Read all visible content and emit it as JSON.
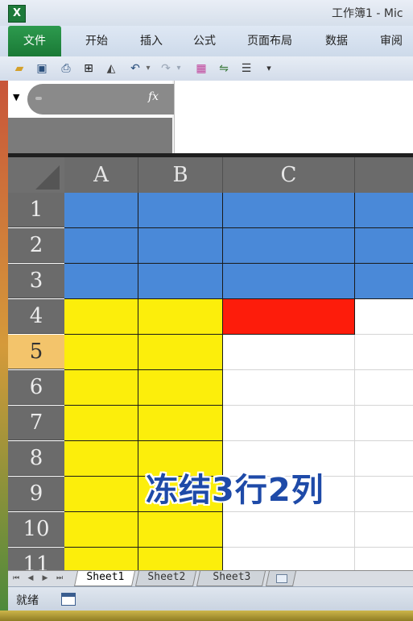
{
  "window": {
    "title": "工作簿1 - Mic"
  },
  "ribbon": {
    "tabs": [
      "文件",
      "开始",
      "插入",
      "公式",
      "页面布局",
      "数据",
      "审阅"
    ]
  },
  "quick_access": {
    "icons": [
      "open-folder-icon",
      "save-icon",
      "print-preview-icon",
      "borders-icon",
      "eraser-icon",
      "undo-icon",
      "redo-icon",
      "format-painter-icon",
      "sort-icon",
      "list-icon",
      "customize-icon"
    ]
  },
  "formula_bar": {
    "fx_label": "fx",
    "name_box_value": "",
    "formula_value": ""
  },
  "grid": {
    "columns": [
      "A",
      "B",
      "C",
      ""
    ],
    "rows": [
      "1",
      "2",
      "3",
      "4",
      "5",
      "6",
      "7",
      "8",
      "9",
      "10",
      "11"
    ],
    "selected_row": "5",
    "colors": {
      "blue": "#4a89d8",
      "yellow": "#fcee0b",
      "red": "#fd1c0b",
      "white": "#ffffff"
    },
    "caption": "冻结3行2列"
  },
  "sheets": {
    "tabs": [
      "Sheet1",
      "Sheet2",
      "Sheet3"
    ],
    "active": "Sheet1"
  },
  "status": {
    "ready": "就绪"
  }
}
